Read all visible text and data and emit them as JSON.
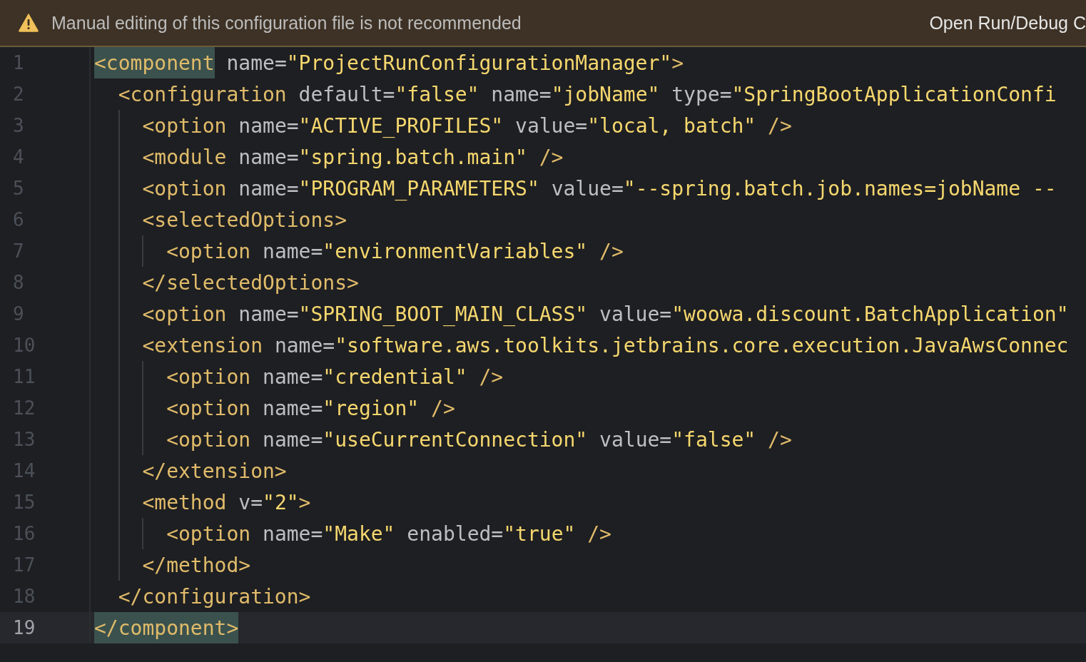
{
  "banner": {
    "message": "Manual editing of this configuration file is not recommended",
    "action": "Open Run/Debug C"
  },
  "editor": {
    "lines": [
      {
        "number": "1",
        "text": "<component name=\"ProjectRunConfigurationManager\">",
        "current": false,
        "tag_match": true
      },
      {
        "number": "2",
        "text": "  <configuration default=\"false\" name=\"jobName\" type=\"SpringBootApplicationConfi",
        "current": false,
        "tag_match": false
      },
      {
        "number": "3",
        "text": "    <option name=\"ACTIVE_PROFILES\" value=\"local, batch\" />",
        "current": false,
        "tag_match": false
      },
      {
        "number": "4",
        "text": "    <module name=\"spring.batch.main\" />",
        "current": false,
        "tag_match": false
      },
      {
        "number": "5",
        "text": "    <option name=\"PROGRAM_PARAMETERS\" value=\"--spring.batch.job.names=jobName --",
        "current": false,
        "tag_match": false
      },
      {
        "number": "6",
        "text": "    <selectedOptions>",
        "current": false,
        "tag_match": false
      },
      {
        "number": "7",
        "text": "      <option name=\"environmentVariables\" />",
        "current": false,
        "tag_match": false
      },
      {
        "number": "8",
        "text": "    </selectedOptions>",
        "current": false,
        "tag_match": false
      },
      {
        "number": "9",
        "text": "    <option name=\"SPRING_BOOT_MAIN_CLASS\" value=\"woowa.discount.BatchApplication\"",
        "current": false,
        "tag_match": false
      },
      {
        "number": "10",
        "text": "    <extension name=\"software.aws.toolkits.jetbrains.core.execution.JavaAwsConnec",
        "current": false,
        "tag_match": false
      },
      {
        "number": "11",
        "text": "      <option name=\"credential\" />",
        "current": false,
        "tag_match": false
      },
      {
        "number": "12",
        "text": "      <option name=\"region\" />",
        "current": false,
        "tag_match": false
      },
      {
        "number": "13",
        "text": "      <option name=\"useCurrentConnection\" value=\"false\" />",
        "current": false,
        "tag_match": false
      },
      {
        "number": "14",
        "text": "    </extension>",
        "current": false,
        "tag_match": false
      },
      {
        "number": "15",
        "text": "    <method v=\"2\">",
        "current": false,
        "tag_match": false
      },
      {
        "number": "16",
        "text": "      <option name=\"Make\" enabled=\"true\" />",
        "current": false,
        "tag_match": false
      },
      {
        "number": "17",
        "text": "    </method>",
        "current": false,
        "tag_match": false
      },
      {
        "number": "18",
        "text": "  </configuration>",
        "current": false,
        "tag_match": false
      },
      {
        "number": "19",
        "text": "</component>",
        "current": true,
        "tag_match": true
      }
    ]
  }
}
